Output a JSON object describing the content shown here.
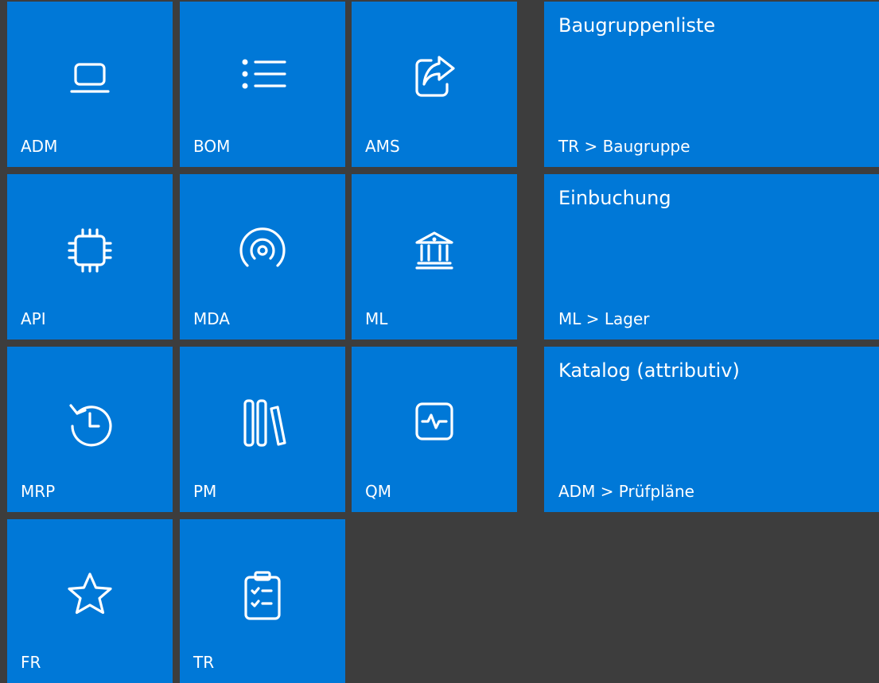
{
  "theme": {
    "background": "#3d3d3d",
    "tile": "#0078d7",
    "text": "#ffffff"
  },
  "tiles": [
    {
      "label": "ADM",
      "icon": "laptop-icon"
    },
    {
      "label": "BOM",
      "icon": "list-icon"
    },
    {
      "label": "AMS",
      "icon": "share-icon"
    },
    {
      "label": "API",
      "icon": "chip-icon"
    },
    {
      "label": "MDA",
      "icon": "signal-icon"
    },
    {
      "label": "ML",
      "icon": "bank-icon"
    },
    {
      "label": "MRP",
      "icon": "history-icon"
    },
    {
      "label": "PM",
      "icon": "library-icon"
    },
    {
      "label": "QM",
      "icon": "activity-icon"
    },
    {
      "label": "FR",
      "icon": "star-icon"
    },
    {
      "label": "TR",
      "icon": "clipboard-check-icon"
    }
  ],
  "shortcuts": [
    {
      "title": "Baugruppenliste",
      "path": "TR > Baugruppe"
    },
    {
      "title": "Einbuchung",
      "path": "ML > Lager"
    },
    {
      "title": "Katalog (attributiv)",
      "path": "ADM > Prüfpläne"
    }
  ]
}
